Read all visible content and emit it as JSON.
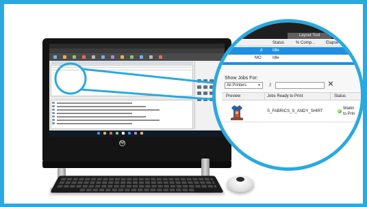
{
  "colors": {
    "accent": "#29a9e0",
    "selection": "#1f8fe3",
    "ready": "#3bae1e"
  },
  "magnifier": {
    "window_title": "Layout Tool",
    "columns": {
      "status": "Status",
      "complete": "% Comp...",
      "elapsed": "Elapse"
    },
    "printer_rows": [
      {
        "name": "d",
        "status": "Idle",
        "selected": true
      },
      {
        "name": "MO",
        "status": "Idle",
        "selected": false
      },
      {
        "name": "",
        "status": "",
        "selected": true
      }
    ],
    "filter_label": "Show Jobs For:",
    "filter_value": "All Printers",
    "filter_icon": "key-icon",
    "clear_icon": "close-icon",
    "table_headers": {
      "preview": "Preview",
      "jobs": "Jobs Ready to Print",
      "status": "Status"
    },
    "job": {
      "name": "S_FABRICS_S_ANDY_SHIRT",
      "status_line1": "Waitin",
      "status_line2": "to Prin",
      "status_icon": "ready-dot-icon",
      "preview_icon": "shirt-preview-icon"
    }
  },
  "device": {
    "logo": "hp"
  }
}
